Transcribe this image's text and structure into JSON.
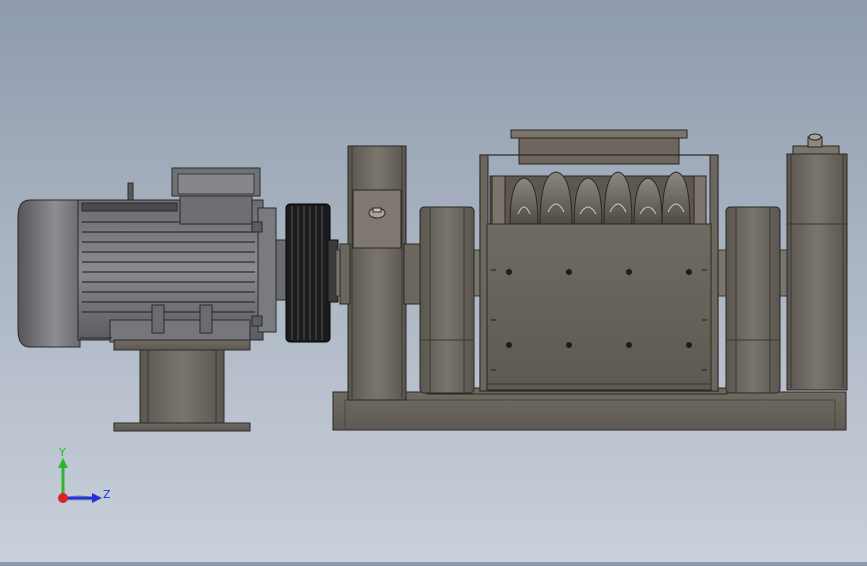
{
  "viewport": {
    "background_top": "#8e9bad",
    "background_bottom": "#c9d0da"
  },
  "model_parts": [
    "motor",
    "v-belt-pulley",
    "bearing-housing-left",
    "crusher-rotor-box",
    "bearing-housing-right",
    "flywheel-left",
    "flywheel-right",
    "base-frame",
    "motor-stand"
  ],
  "triad": {
    "y_label": "Y",
    "z_label": "Z",
    "y_color": "#2fb52f",
    "z_color": "#2430d8",
    "x_color": "#d82424"
  }
}
